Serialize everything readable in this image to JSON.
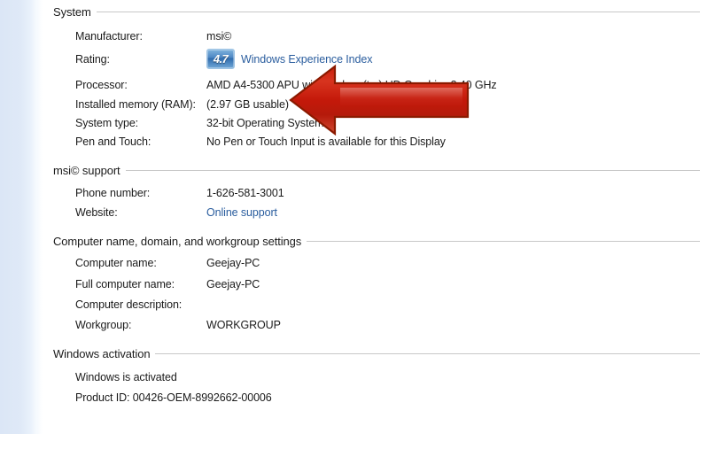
{
  "theme": {
    "text_color": "#1b1b1b",
    "link_color": "#2a5d9e",
    "rule_color": "#c8c8c8",
    "gutter_color": "#dbe6f6",
    "arrow_fill": "#d62b18",
    "arrow_border": "#8b1a00",
    "badge_color": "#4e88c4"
  },
  "sections": {
    "system": {
      "header": "System",
      "rows": [
        {
          "label": "Manufacturer:",
          "value": "msi©"
        },
        {
          "label": "Rating:",
          "badge": "4.7",
          "link": "Windows Experience Index"
        },
        {
          "label": "Processor:",
          "value": "AMD A4-5300 APU with Radeon(tm) HD Graphics      3.40 GHz"
        },
        {
          "label": "Installed memory (RAM):",
          "value": "(2.97 GB usable)"
        },
        {
          "label": "System type:",
          "value": "32-bit Operating System"
        },
        {
          "label": "Pen and Touch:",
          "value": "No Pen or Touch Input is available for this Display"
        }
      ]
    },
    "support": {
      "header": "msi© support",
      "rows": [
        {
          "label": "Phone number:",
          "value": "1-626-581-3001"
        },
        {
          "label": "Website:",
          "value": "Online support",
          "is_link": true
        }
      ]
    },
    "computer_name": {
      "header": "Computer name, domain, and workgroup settings",
      "rows": [
        {
          "label": "Computer name:",
          "value": "Geejay-PC"
        },
        {
          "label": "Full computer name:",
          "value": "Geejay-PC"
        },
        {
          "label": "Computer description:",
          "value": ""
        },
        {
          "label": "Workgroup:",
          "value": "WORKGROUP"
        }
      ]
    },
    "activation": {
      "header": "Windows activation",
      "status": "Windows is activated",
      "product_id": "Product ID: 00426-OEM-8992662-00006"
    }
  },
  "annotation": {
    "type": "left-pointing-arrow",
    "target": "Installed memory (RAM)"
  }
}
